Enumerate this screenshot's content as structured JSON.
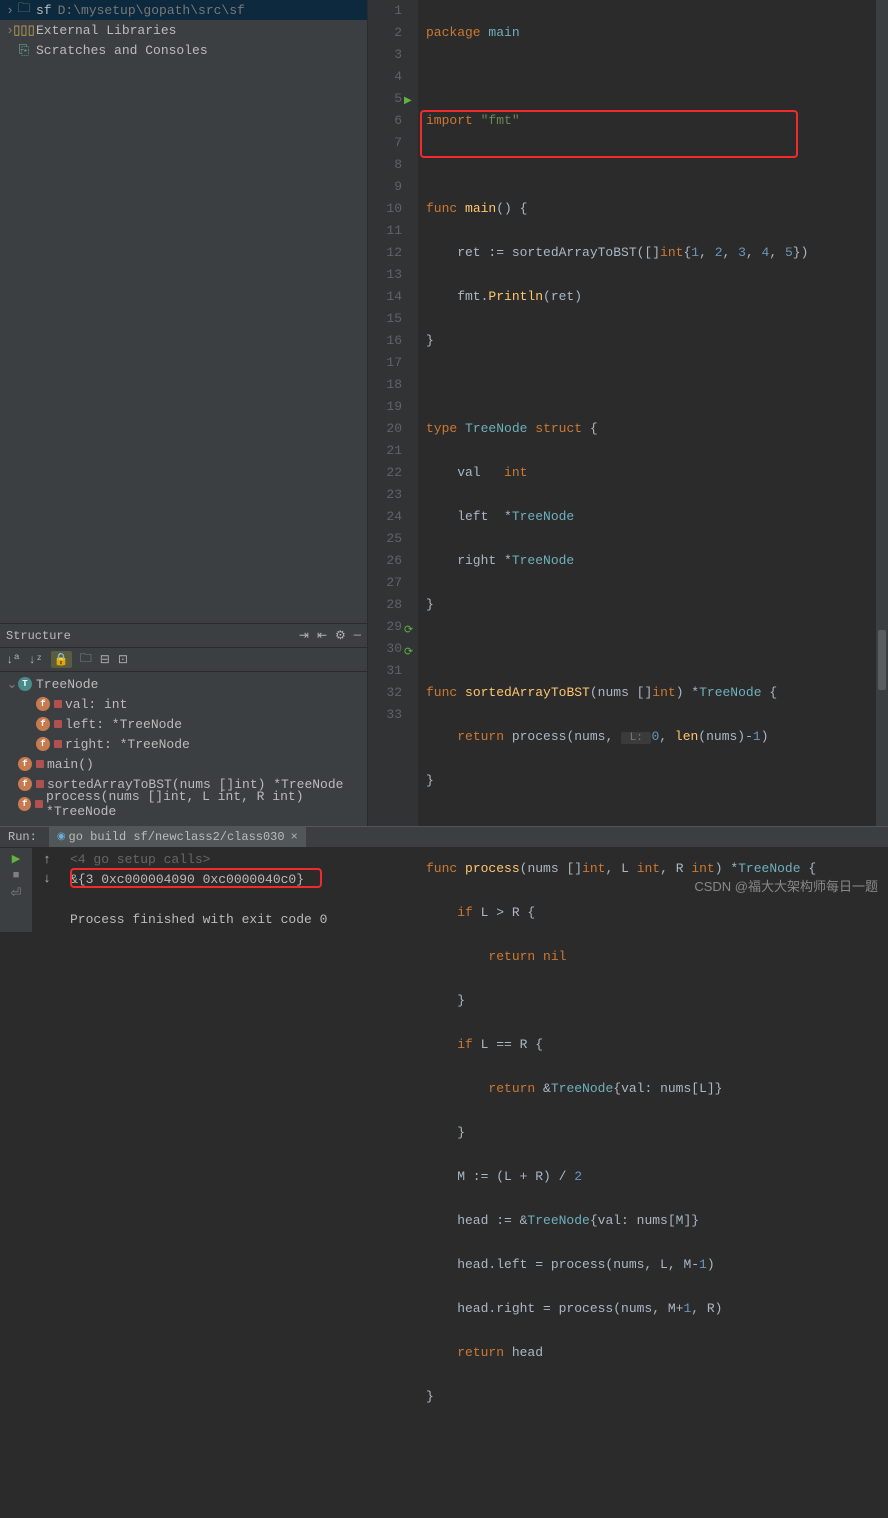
{
  "project": {
    "root_name": "sf",
    "root_path": "D:\\mysetup\\gopath\\src\\sf",
    "external_libs": "External Libraries",
    "scratches": "Scratches and Consoles"
  },
  "structure": {
    "title": "Structure",
    "items": {
      "treenode": "TreeNode",
      "val": "val: int",
      "left": "left: *TreeNode",
      "right": "right: *TreeNode",
      "main": "main()",
      "sorted": "sortedArrayToBST(nums []int) *TreeNode",
      "process": "process(nums []int, L int, R int) *TreeNode"
    }
  },
  "code": {
    "l1": "package main",
    "l3": "import \"fmt\"",
    "l5": "func main() {",
    "l6a": "    ret := sortedArrayToBST([]",
    "l6b": "int",
    "l6c": "{",
    "l6nums": "1, 2, 3, 4, 5",
    "l6d": "})",
    "l7": "    fmt.Println(ret)",
    "l8": "}",
    "l10": "type TreeNode struct {",
    "l11": "    val   int",
    "l12": "    left  *TreeNode",
    "l13": "    right *TreeNode",
    "l14": "}",
    "l16": "func sortedArrayToBST(nums []int) *TreeNode {",
    "l17a": "    return process(nums, ",
    "l17hint": " L: ",
    "l17b": "0",
    "l17c": ", len(nums)-",
    "l17d": "1",
    "l17e": ")",
    "l18": "}",
    "l20": "func process(nums []int, L int, R int) *TreeNode {",
    "l21": "    if L > R {",
    "l22": "        return nil",
    "l23": "    }",
    "l24": "    if L == R {",
    "l25": "        return &TreeNode{val: nums[L]}",
    "l26": "    }",
    "l27": "    M := (L + R) / 2",
    "l28": "    head := &TreeNode{val: nums[M]}",
    "l29": "    head.left = process(nums, L, M-1)",
    "l30": "    head.right = process(nums, M+1, R)",
    "l31": "    return head",
    "l32": "}"
  },
  "lines": [
    "1",
    "2",
    "3",
    "4",
    "5",
    "6",
    "7",
    "8",
    "9",
    "10",
    "11",
    "12",
    "13",
    "14",
    "15",
    "16",
    "17",
    "18",
    "19",
    "20",
    "21",
    "22",
    "23",
    "24",
    "25",
    "26",
    "27",
    "28",
    "29",
    "30",
    "31",
    "32",
    "33"
  ],
  "run": {
    "label": "Run:",
    "tab_name": "go build sf/newclass2/class030",
    "out0": "<4 go setup calls>",
    "out1": "&{3 0xc000004090 0xc0000040c0}",
    "out3": "Process finished with exit code 0"
  },
  "watermark": "CSDN @福大大架构师每日一题"
}
